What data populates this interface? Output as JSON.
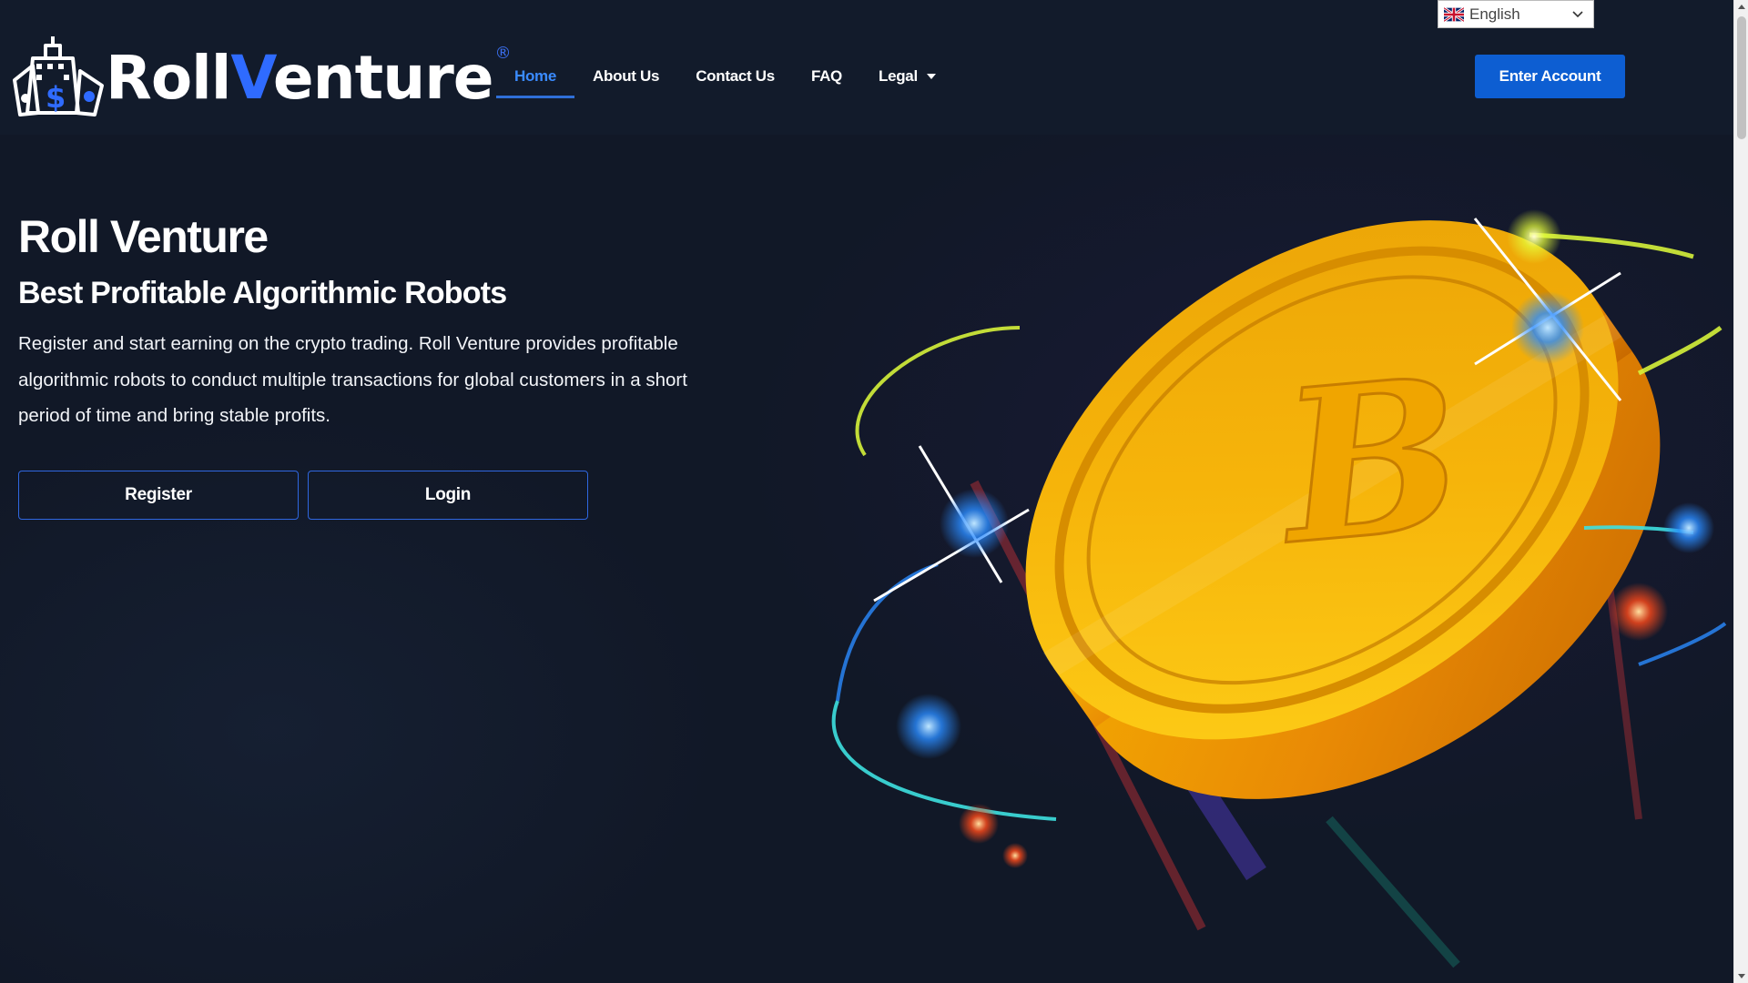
{
  "language_selector": {
    "selected": "English",
    "flag_icon": "uk-flag-icon"
  },
  "header": {
    "logo": {
      "text_main": "Roll",
      "text_accent": "V",
      "text_rest": "enture",
      "registered_mark": "®",
      "accent_color": "#2f6bff"
    },
    "nav": [
      {
        "label": "Home",
        "active": true
      },
      {
        "label": "About Us",
        "active": false
      },
      {
        "label": "Contact Us",
        "active": false
      },
      {
        "label": "FAQ",
        "active": false
      },
      {
        "label": "Legal",
        "active": false,
        "has_dropdown": true
      }
    ],
    "cta_label": "Enter Account"
  },
  "hero": {
    "title": "Roll Venture",
    "subtitle": "Best Profitable Algorithmic Robots",
    "description": "Register and start earning on the crypto trading. Roll Venture provides profitable algorithmic robots to conduct multiple transactions for global customers in a short period of time and bring stable profits.",
    "register_label": "Register",
    "login_label": "Login"
  },
  "colors": {
    "background": "#111827",
    "primary_button": "#0d5ed2",
    "active_nav": "#3a8bff",
    "coin_gold": "#f5b400"
  },
  "icons": {
    "logo_mark": "building-dollar-icon",
    "hero_image": "bitcoin-coin-icon",
    "dropdown": "caret-down-icon",
    "lang_dropdown": "chevron-down-icon"
  }
}
